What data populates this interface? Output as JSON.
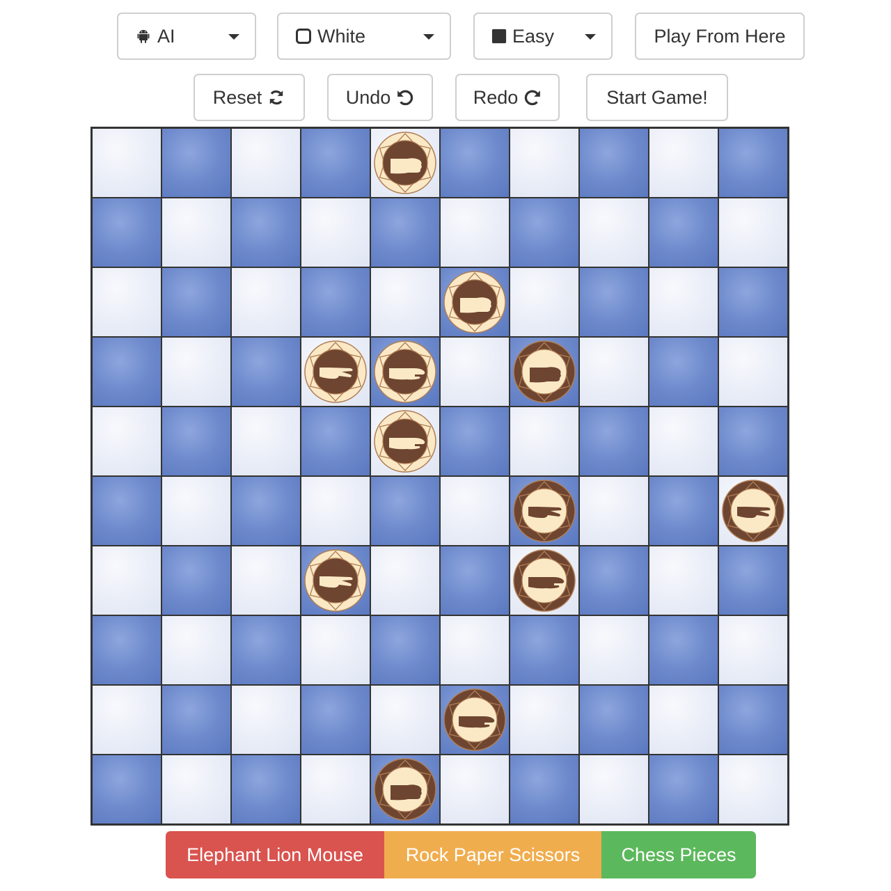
{
  "controls": {
    "player": {
      "label": "AI",
      "icon": "android-icon"
    },
    "color": {
      "label": "White",
      "icon": "empty-square-icon"
    },
    "difficulty": {
      "label": "Easy",
      "icon": "filled-square-icon"
    },
    "play_from_here": "Play From Here",
    "reset": "Reset",
    "undo": "Undo",
    "redo": "Redo",
    "start": "Start Game!"
  },
  "board": {
    "rows": 10,
    "cols": 10,
    "light_color": "#e9edf7",
    "dark_color": "#6e8acc",
    "pieces": [
      {
        "row": 0,
        "col": 4,
        "kind": "rock",
        "side": "white"
      },
      {
        "row": 2,
        "col": 5,
        "kind": "rock",
        "side": "white"
      },
      {
        "row": 3,
        "col": 3,
        "kind": "scissors",
        "side": "white"
      },
      {
        "row": 3,
        "col": 4,
        "kind": "paper",
        "side": "white"
      },
      {
        "row": 3,
        "col": 6,
        "kind": "rock",
        "side": "brown"
      },
      {
        "row": 4,
        "col": 4,
        "kind": "paper",
        "side": "white"
      },
      {
        "row": 5,
        "col": 6,
        "kind": "scissors",
        "side": "brown"
      },
      {
        "row": 5,
        "col": 9,
        "kind": "scissors",
        "side": "brown"
      },
      {
        "row": 6,
        "col": 3,
        "kind": "scissors",
        "side": "white"
      },
      {
        "row": 6,
        "col": 6,
        "kind": "paper",
        "side": "brown"
      },
      {
        "row": 8,
        "col": 5,
        "kind": "paper",
        "side": "brown"
      },
      {
        "row": 9,
        "col": 4,
        "kind": "rock",
        "side": "brown"
      }
    ]
  },
  "game_tabs": [
    {
      "label": "Elephant Lion Mouse",
      "color": "#d9534f"
    },
    {
      "label": "Rock Paper Scissors",
      "color": "#f0ad4e"
    },
    {
      "label": "Chess Pieces",
      "color": "#5cb85c"
    }
  ]
}
